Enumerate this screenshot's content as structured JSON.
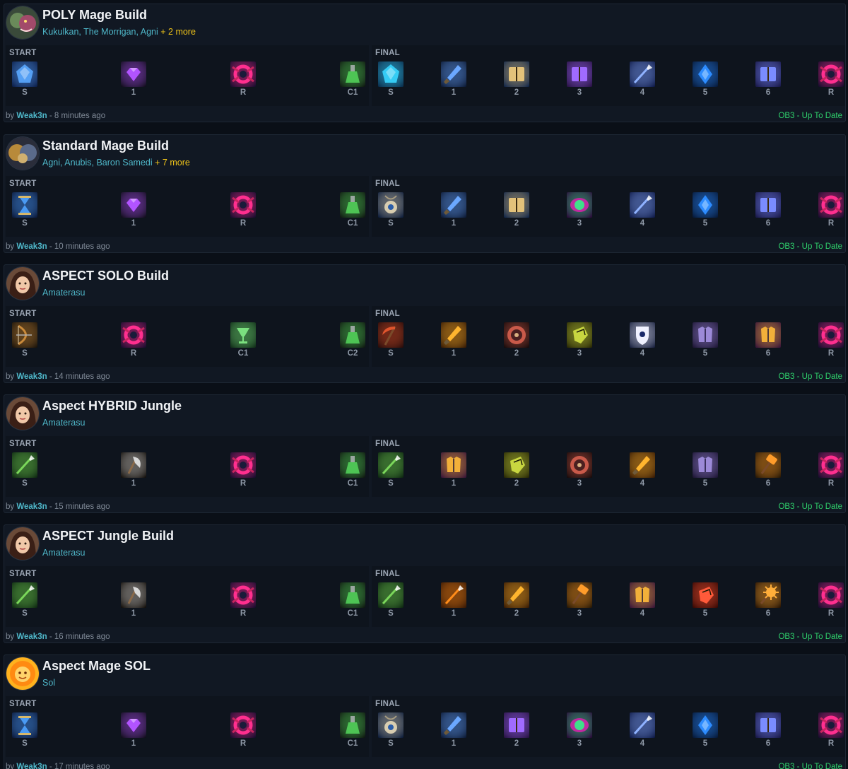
{
  "builds": [
    {
      "title": "POLY Mage Build",
      "avatar_icon": "poly-god-portrait-icon",
      "gods": "Kukulkan, The Morrigan, Agni",
      "more": "+ 2 more",
      "start": [
        {
          "label": "S",
          "icon": "blue-starter-crystal"
        },
        {
          "label": "1",
          "icon": "purple-gem"
        },
        {
          "label": "R",
          "icon": "pink-relic"
        },
        {
          "label": "C1",
          "icon": "green-potion"
        }
      ],
      "final": [
        {
          "label": "S",
          "icon": "cyan-crystal"
        },
        {
          "label": "1",
          "icon": "blue-dagger"
        },
        {
          "label": "2",
          "icon": "spell-book"
        },
        {
          "label": "3",
          "icon": "purple-tome"
        },
        {
          "label": "4",
          "icon": "blue-spear"
        },
        {
          "label": "5",
          "icon": "blue-shard"
        },
        {
          "label": "6",
          "icon": "rune-book"
        },
        {
          "label": "R",
          "icon": "pink-relic"
        }
      ],
      "by": "by",
      "author": "Weak3n",
      "time": "- 8 minutes ago",
      "status": "OB3 - Up To Date"
    },
    {
      "title": "Standard Mage Build",
      "avatar_icon": "standard-god-portrait-icon",
      "gods": "Agni, Anubis, Baron Samedi",
      "more": "+ 7 more",
      "start": [
        {
          "label": "S",
          "icon": "blue-hourglass"
        },
        {
          "label": "1",
          "icon": "purple-gem"
        },
        {
          "label": "R",
          "icon": "pink-relic"
        },
        {
          "label": "C1",
          "icon": "green-potion"
        }
      ],
      "final": [
        {
          "label": "S",
          "icon": "amulet"
        },
        {
          "label": "1",
          "icon": "blue-dagger"
        },
        {
          "label": "2",
          "icon": "spell-book"
        },
        {
          "label": "3",
          "icon": "green-orb"
        },
        {
          "label": "4",
          "icon": "blue-spear"
        },
        {
          "label": "5",
          "icon": "blue-shard"
        },
        {
          "label": "6",
          "icon": "rune-book"
        },
        {
          "label": "R",
          "icon": "pink-relic"
        }
      ],
      "by": "by",
      "author": "Weak3n",
      "time": "- 10 minutes ago",
      "status": "OB3 - Up To Date"
    },
    {
      "title": "ASPECT SOLO Build",
      "avatar_icon": "amaterasu-portrait-icon",
      "gods": "Amaterasu",
      "more": "",
      "start": [
        {
          "label": "S",
          "icon": "bronze-bow"
        },
        {
          "label": "R",
          "icon": "pink-relic"
        },
        {
          "label": "C1",
          "icon": "green-chalice"
        },
        {
          "label": "C2",
          "icon": "green-potion"
        }
      ],
      "final": [
        {
          "label": "S",
          "icon": "crimson-scythe"
        },
        {
          "label": "1",
          "icon": "golden-sword"
        },
        {
          "label": "2",
          "icon": "round-shield"
        },
        {
          "label": "3",
          "icon": "gold-gauntlet"
        },
        {
          "label": "4",
          "icon": "white-shield"
        },
        {
          "label": "5",
          "icon": "violet-armor"
        },
        {
          "label": "6",
          "icon": "gold-armor"
        },
        {
          "label": "R",
          "icon": "pink-relic"
        }
      ],
      "by": "by",
      "author": "Weak3n",
      "time": "- 14 minutes ago",
      "status": "OB3 - Up To Date"
    },
    {
      "title": "Aspect HYBRID Jungle",
      "avatar_icon": "amaterasu-portrait-icon",
      "gods": "Amaterasu",
      "more": "",
      "start": [
        {
          "label": "S",
          "icon": "green-spear"
        },
        {
          "label": "1",
          "icon": "axe"
        },
        {
          "label": "R",
          "icon": "pink-relic"
        },
        {
          "label": "C1",
          "icon": "green-potion"
        }
      ],
      "final": [
        {
          "label": "S",
          "icon": "green-spear"
        },
        {
          "label": "1",
          "icon": "gold-armor"
        },
        {
          "label": "2",
          "icon": "gold-gauntlet"
        },
        {
          "label": "3",
          "icon": "round-shield"
        },
        {
          "label": "4",
          "icon": "golden-sword"
        },
        {
          "label": "5",
          "icon": "violet-armor"
        },
        {
          "label": "6",
          "icon": "war-hammer"
        },
        {
          "label": "R",
          "icon": "pink-relic"
        }
      ],
      "by": "by",
      "author": "Weak3n",
      "time": "- 15 minutes ago",
      "status": "OB3 - Up To Date"
    },
    {
      "title": "ASPECT Jungle Build",
      "avatar_icon": "amaterasu-portrait-icon",
      "gods": "Amaterasu",
      "more": "",
      "start": [
        {
          "label": "S",
          "icon": "green-spear"
        },
        {
          "label": "1",
          "icon": "axe"
        },
        {
          "label": "R",
          "icon": "pink-relic"
        },
        {
          "label": "C1",
          "icon": "green-potion"
        }
      ],
      "final": [
        {
          "label": "S",
          "icon": "green-spear"
        },
        {
          "label": "1",
          "icon": "orange-spear"
        },
        {
          "label": "2",
          "icon": "golden-sword"
        },
        {
          "label": "3",
          "icon": "war-hammer"
        },
        {
          "label": "4",
          "icon": "gold-armor"
        },
        {
          "label": "5",
          "icon": "red-gauntlet"
        },
        {
          "label": "6",
          "icon": "spiked-mace"
        },
        {
          "label": "R",
          "icon": "pink-relic"
        }
      ],
      "by": "by",
      "author": "Weak3n",
      "time": "- 16 minutes ago",
      "status": "OB3 - Up To Date"
    },
    {
      "title": "Aspect Mage SOL",
      "avatar_icon": "sol-portrait-icon",
      "gods": "Sol",
      "more": "",
      "start": [
        {
          "label": "S",
          "icon": "blue-hourglass"
        },
        {
          "label": "1",
          "icon": "purple-gem"
        },
        {
          "label": "R",
          "icon": "pink-relic"
        },
        {
          "label": "C1",
          "icon": "green-potion"
        }
      ],
      "final": [
        {
          "label": "S",
          "icon": "amulet"
        },
        {
          "label": "1",
          "icon": "blue-dagger"
        },
        {
          "label": "2",
          "icon": "purple-tome"
        },
        {
          "label": "3",
          "icon": "green-orb"
        },
        {
          "label": "4",
          "icon": "blue-spear"
        },
        {
          "label": "5",
          "icon": "blue-shard"
        },
        {
          "label": "6",
          "icon": "rune-book"
        },
        {
          "label": "R",
          "icon": "pink-relic"
        }
      ],
      "by": "by",
      "author": "Weak3n",
      "time": "- 17 minutes ago",
      "status": "OB3 - Up To Date"
    }
  ]
}
